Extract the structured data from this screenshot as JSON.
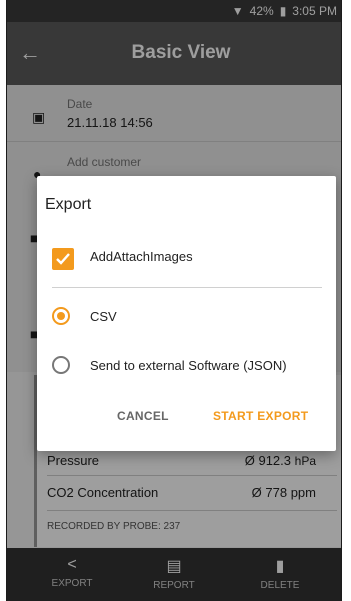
{
  "status": {
    "battery": "42%",
    "time": "3:05 PM"
  },
  "appbar": {
    "title": "Basic View",
    "back_icon": "arrow-left-icon"
  },
  "rows": {
    "date_label": "Date",
    "date_value": "21.11.18 14:56",
    "customer_label": "Add customer"
  },
  "measurements": [
    {
      "name": "Pressure",
      "value": "Ø 912.3",
      "unit": "hPa"
    },
    {
      "name": "CO2 Concentration",
      "value": "Ø 778",
      "unit": "ppm"
    }
  ],
  "recorded_by": {
    "label": "RECORDED BY PROBE:",
    "value": "237"
  },
  "bottom_nav": {
    "export": "EXPORT",
    "report": "REPORT",
    "delete": "DELETE"
  },
  "dialog": {
    "title": "Export",
    "checkbox_label": "AddAttachImages",
    "checkbox_checked": true,
    "options": [
      {
        "label": "CSV",
        "selected": true
      },
      {
        "label": "Send to external Software (JSON)",
        "selected": false
      }
    ],
    "cancel": "CANCEL",
    "start": "START EXPORT"
  },
  "colors": {
    "accent": "#f39a1d",
    "appbar": "#5b5b5b",
    "bottombar": "#333333"
  }
}
